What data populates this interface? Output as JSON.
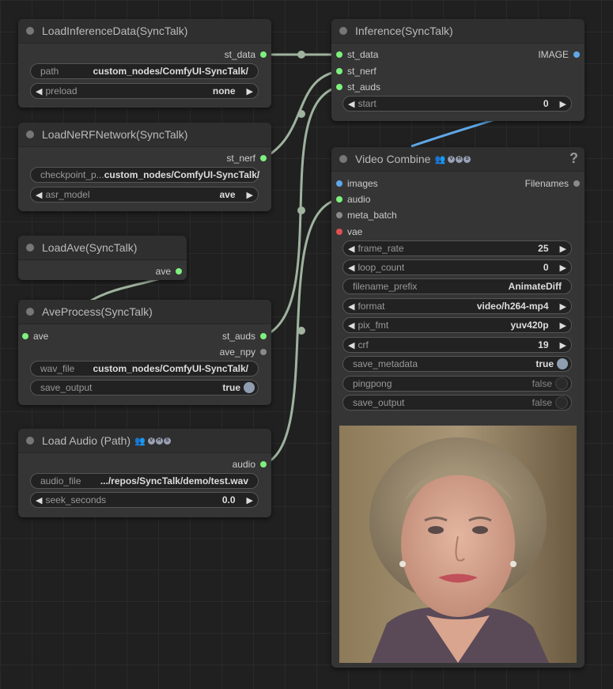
{
  "nodes": {
    "load_inference_data": {
      "title": "LoadInferenceData(SyncTalk)",
      "output": "st_data",
      "path_label": "path",
      "path_value": "custom_nodes/ComfyUI-SyncTalk/",
      "preload_label": "preload",
      "preload_value": "none"
    },
    "load_nerf": {
      "title": "LoadNeRFNetwork(SyncTalk)",
      "output": "st_nerf",
      "checkpoint_label": "checkpoint_p...",
      "checkpoint_value": "custom_nodes/ComfyUI-SyncTalk/",
      "asr_label": "asr_model",
      "asr_value": "ave"
    },
    "load_ave": {
      "title": "LoadAve(SyncTalk)",
      "output": "ave"
    },
    "ave_process": {
      "title": "AveProcess(SyncTalk)",
      "input": "ave",
      "output1": "st_auds",
      "output2": "ave_npy",
      "wav_label": "wav_file",
      "wav_value": "custom_nodes/ComfyUI-SyncTalk/",
      "save_label": "save_output",
      "save_value": "true"
    },
    "load_audio": {
      "title": "Load Audio (Path)",
      "output": "audio",
      "file_label": "audio_file",
      "file_value": ".../repos/SyncTalk/demo/test.wav",
      "seek_label": "seek_seconds",
      "seek_value": "0.0"
    },
    "inference": {
      "title": "Inference(SyncTalk)",
      "inputs": [
        "st_data",
        "st_nerf",
        "st_auds"
      ],
      "output": "IMAGE",
      "start_label": "start",
      "start_value": "0"
    },
    "video_combine": {
      "title": "Video Combine",
      "help": "?",
      "inputs": [
        "images",
        "audio",
        "meta_batch",
        "vae"
      ],
      "output": "Filenames",
      "widgets": [
        {
          "label": "frame_rate",
          "value": "25"
        },
        {
          "label": "loop_count",
          "value": "0"
        },
        {
          "label": "filename_prefix",
          "value": "AnimateDiff"
        },
        {
          "label": "format",
          "value": "video/h264-mp4"
        },
        {
          "label": "pix_fmt",
          "value": "yuv420p"
        },
        {
          "label": "crf",
          "value": "19"
        },
        {
          "label": "save_metadata",
          "value": "true"
        },
        {
          "label": "pingpong",
          "value": "false"
        },
        {
          "label": "save_output",
          "value": "false"
        }
      ]
    }
  },
  "vhs_badges": [
    "V",
    "H",
    "S"
  ],
  "colors": {
    "link": "#9fb39f",
    "image_link": "#5fa8e8",
    "connected_slot": "#7ef07e"
  }
}
